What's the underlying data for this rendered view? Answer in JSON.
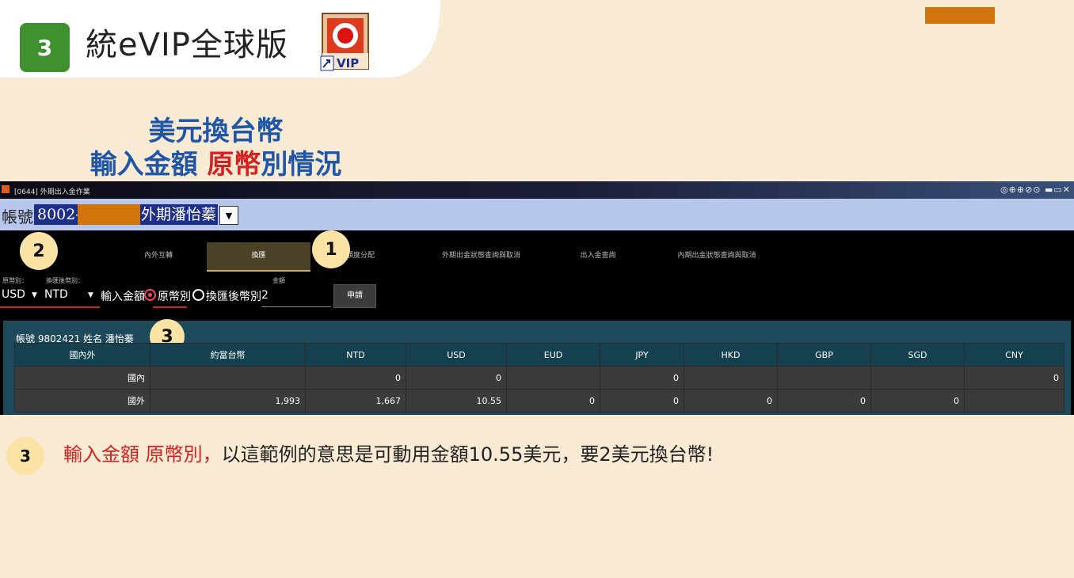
{
  "header": {
    "step_number": "3",
    "app_title": "統eVIP全球版",
    "icon_name": "evip-app-icon"
  },
  "headline": {
    "line1": "美元換台幣",
    "line2_blue": "輸入金額 ",
    "line2_red": "原幣",
    "line2_tail": "別情況"
  },
  "window": {
    "title": "[0644] 外期出入金作業",
    "controls": "◎⊕⊕⊘⊙ ▬▭✕"
  },
  "account": {
    "label": "帳號",
    "number": "8002-",
    "name": "外期潘怡蓁"
  },
  "tabs": [
    "內外互轉",
    "換匯",
    "額度分配",
    "外期出金狀態查詢與取消",
    "出入金查詢",
    "內期出金狀態查詢與取消"
  ],
  "active_tab": "換匯",
  "markers": {
    "m1": "1",
    "m2": "2",
    "m3": "3"
  },
  "form": {
    "src_label": "原幣別：",
    "dst_label": "換匯後幣別：",
    "amount_label": "金額",
    "src_value": "USD",
    "dst_value": "NTD",
    "input_amount": "輸入金額",
    "radio_original": "原幣別",
    "radio_converted": "換匯後幣別",
    "amount_value": "2",
    "apply_button": "申請"
  },
  "panel": {
    "title": "帳號 9802421 姓名 潘怡蓁",
    "columns": [
      "國內外",
      "約當台幣",
      "NTD",
      "USD",
      "EUD",
      "JPY",
      "HKD",
      "GBP",
      "SGD",
      "CNY"
    ],
    "rows": [
      [
        "國內",
        "",
        "0",
        "0",
        "",
        "0",
        "",
        "",
        "",
        "0"
      ],
      [
        "國外",
        "1,993",
        "1,667",
        "10.55",
        "0",
        "0",
        "0",
        "0",
        "0",
        ""
      ]
    ]
  },
  "note": {
    "badge": "3",
    "red_part": "輸入金額 原幣別，",
    "black_part": "以這範例的意思是可動用金額10.55美元，要2美元換台幣!"
  }
}
